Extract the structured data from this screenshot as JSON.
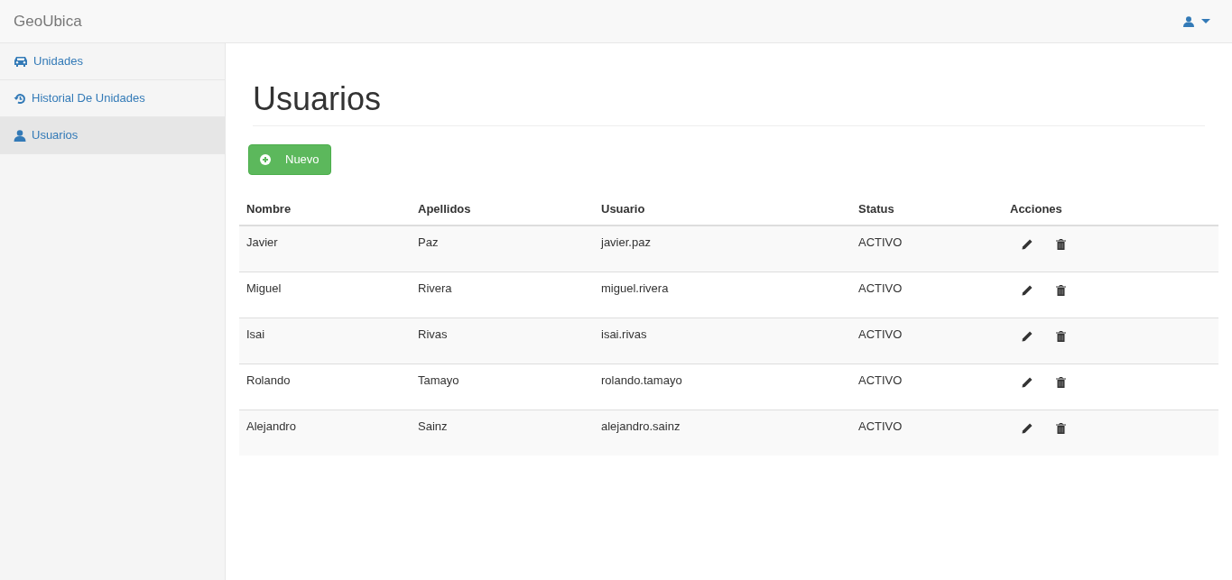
{
  "navbar": {
    "brand": "GeoUbica"
  },
  "sidebar": {
    "items": [
      {
        "label": "Unidades",
        "selected": false
      },
      {
        "label": "Historial De Unidades",
        "selected": false
      },
      {
        "label": "Usuarios",
        "selected": true
      }
    ]
  },
  "page": {
    "title": "Usuarios",
    "new_button": "Nuevo"
  },
  "table": {
    "columns": [
      "Nombre",
      "Apellidos",
      "Usuario",
      "Status",
      "Acciones"
    ],
    "rows": [
      [
        "Javier",
        "Paz",
        "javier.paz",
        "ACTIVO"
      ],
      [
        "Miguel",
        "Rivera",
        "miguel.rivera",
        "ACTIVO"
      ],
      [
        "Isai",
        "Rivas",
        "isai.rivas",
        "ACTIVO"
      ],
      [
        "Rolando",
        "Tamayo",
        "rolando.tamayo",
        "ACTIVO"
      ],
      [
        "Alejandro",
        "Sainz",
        "alejandro.sainz",
        "ACTIVO"
      ]
    ]
  }
}
